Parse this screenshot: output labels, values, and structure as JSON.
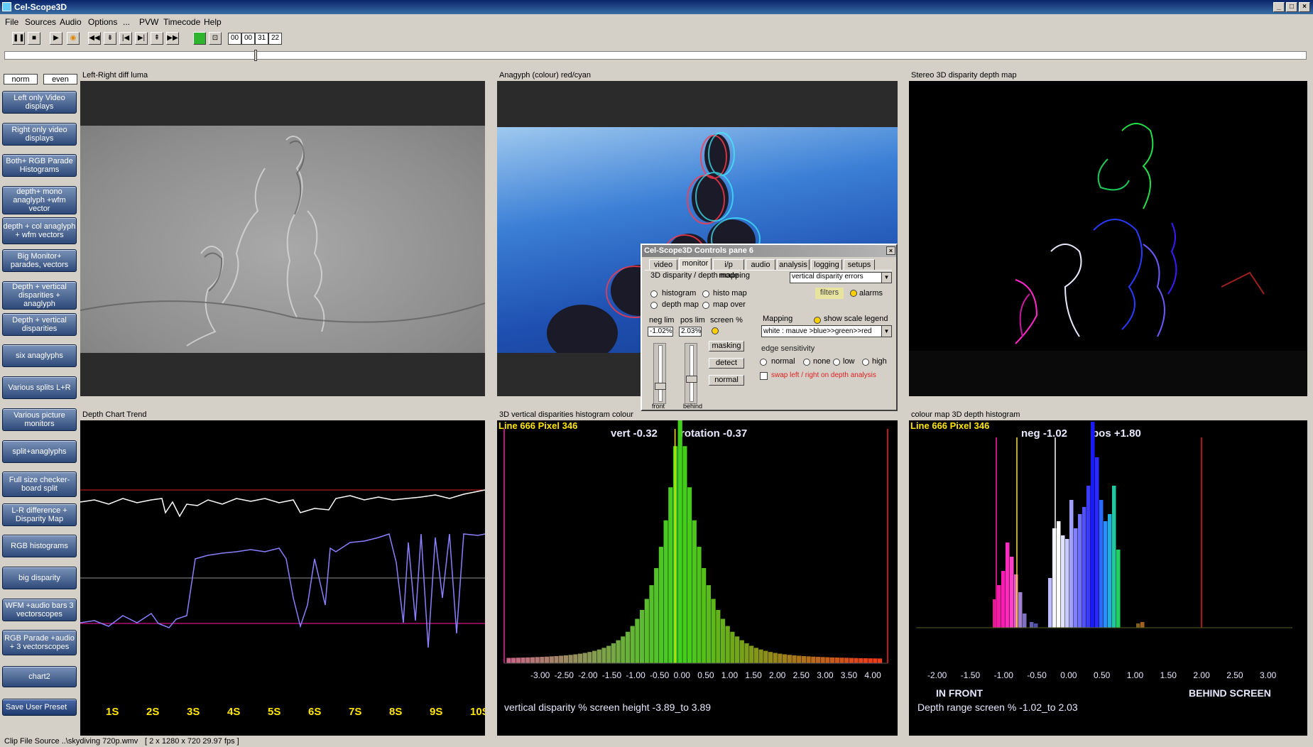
{
  "window": {
    "title": "Cel-Scope3D"
  },
  "menu": [
    "File",
    "Sources",
    "Audio",
    "Options",
    "...",
    "PVW",
    "Timecode",
    "Help"
  ],
  "timecode": [
    "00",
    "00",
    "31",
    "22"
  ],
  "sidebar": {
    "norm": "norm",
    "even": "even",
    "buttons": [
      "Left only Video displays",
      "Right only video displays",
      "Both+ RGB Parade Histograms",
      "depth+ mono anaglyph +wfm vector",
      "depth + col anaglyph + wfm vectors",
      "Big Monitor+ parades, vectors",
      "Depth + vertical disparities + anaglyph",
      "Depth + vertical disparities",
      "six anaglyphs",
      "Various splits L+R",
      "Various picture monitors",
      "split+anaglyphs",
      "Full size checker-board split",
      "L-R difference + Disparity Map",
      "RGB histograms",
      "big disparity",
      "WFM +audio bars 3 vectorscopes",
      "RGB Parade +audio + 3 vectorscopes",
      "chart2",
      "Save User Preset"
    ]
  },
  "panes": {
    "p1": "Left-Right diff luma",
    "p2": "Anagyph (colour) red/cyan",
    "p3": "Stereo 3D disparity depth map",
    "p4": "Depth Chart Trend",
    "p5": "3D vertical disparities histogram colour",
    "p6": "colour map 3D depth histogram"
  },
  "trend": {
    "ticks": [
      "1S",
      "2S",
      "3S",
      "4S",
      "5S",
      "6S",
      "7S",
      "8S",
      "9S",
      "10S"
    ]
  },
  "vhist": {
    "line": "Line 666 Pixel 346",
    "vert": "vert -0.32",
    "rotation": "rotation -0.37",
    "ticks": [
      "-3.00",
      "-2.50",
      "-2.00",
      "-1.50",
      "-1.00",
      "-0.50",
      "0.00",
      "0.50",
      "1.00",
      "1.50",
      "2.00",
      "2.50",
      "3.00",
      "3.50",
      "4.00"
    ],
    "footer": "vertical disparity % screen height   -3.89_to 3.89",
    "colors": {
      "bar_center": "#3fd21a",
      "marker": "#ffe600",
      "edge_left": "#ff1aa8",
      "edge_right": "#ff2020"
    }
  },
  "dhist": {
    "line": "Line 666 Pixel 346",
    "neg": "neg -1.02",
    "pos": "pos +1.80",
    "ticks": [
      "-2.00",
      "-1.50",
      "-1.00",
      "-0.50",
      "0.00",
      "0.50",
      "1.00",
      "1.50",
      "2.00",
      "2.50",
      "3.00"
    ],
    "in_front": "IN FRONT",
    "behind": "BEHIND SCREEN",
    "footer": "Depth range screen %   -1.02_to 2.03"
  },
  "dialog": {
    "title": "Cel-Scope3D Controls  pane 6",
    "tabs": [
      "video",
      "monitor",
      "i/p mode",
      "audio",
      "analysis",
      "logging",
      "setups"
    ],
    "section": "3D disparity / depth mapping",
    "mode_select": "vertical disparity errors",
    "filters": "filters",
    "alarms": "alarms",
    "radios": [
      "histogram",
      "histo map",
      "depth map",
      "map over"
    ],
    "neg_lim_label": "neg lim",
    "pos_lim_label": "pos lim",
    "screen_pct": "screen %",
    "neg_lim": "-1.02%",
    "pos_lim": "2.03%",
    "mapping_label": "Mapping",
    "show_scale": "show scale legend",
    "mapping_value": "white : mauve >blue>>green>>red",
    "masking": "masking",
    "detect": "detect",
    "normal_btn": "normal",
    "edge_label": "edge sensitivity",
    "edge_opts": [
      "normal",
      "none",
      "low",
      "high"
    ],
    "swap": "swap left / right on depth analysis",
    "front": "front",
    "behind": "behind"
  },
  "status": {
    "source": "Clip File Source ..\\skydiving 720p.wmv",
    "info": "[ 2 x 1280 x 720 29.97 fps ]"
  }
}
